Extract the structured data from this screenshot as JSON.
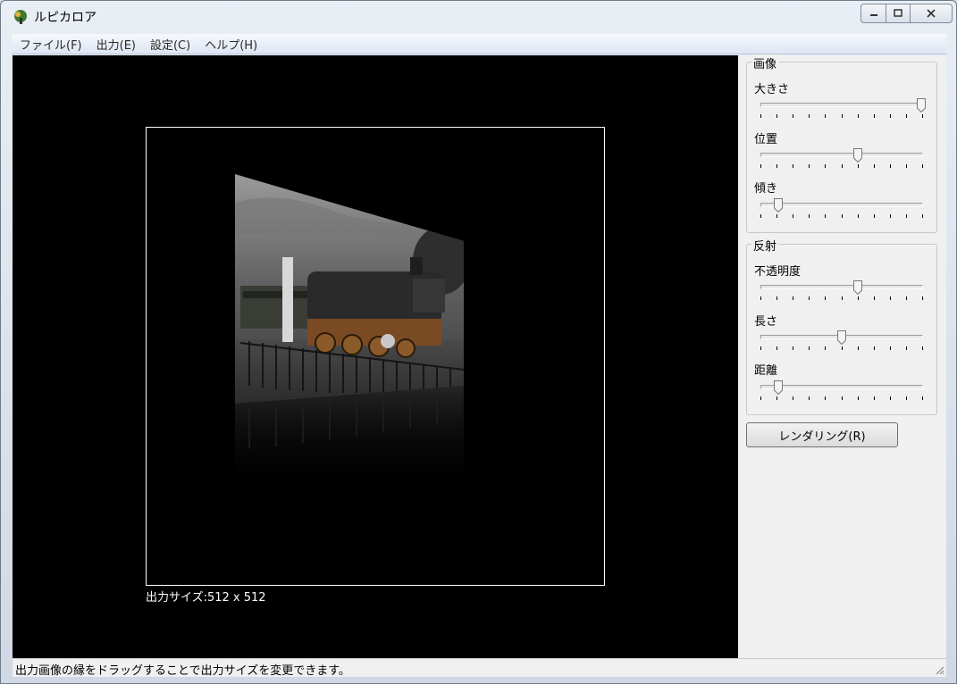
{
  "window": {
    "title": "ルピカロア",
    "icon": "app-icon"
  },
  "menu": [
    {
      "label": "ファイル(F)"
    },
    {
      "label": "出力(E)"
    },
    {
      "label": "設定(C)"
    },
    {
      "label": "ヘルプ(H)"
    }
  ],
  "preview": {
    "output_size_label": "出力サイズ:512 x 512"
  },
  "panel": {
    "image_group": {
      "title": "画像",
      "sliders": [
        {
          "label": "大きさ",
          "value": 1.0
        },
        {
          "label": "位置",
          "value": 0.6
        },
        {
          "label": "傾き",
          "value": 0.1
        }
      ]
    },
    "reflection_group": {
      "title": "反射",
      "sliders": [
        {
          "label": "不透明度",
          "value": 0.6
        },
        {
          "label": "長さ",
          "value": 0.5
        },
        {
          "label": "距離",
          "value": 0.1
        }
      ]
    },
    "render_button": "レンダリング(R)"
  },
  "status": {
    "text": "出力画像の縁をドラッグすることで出力サイズを変更できます。"
  }
}
